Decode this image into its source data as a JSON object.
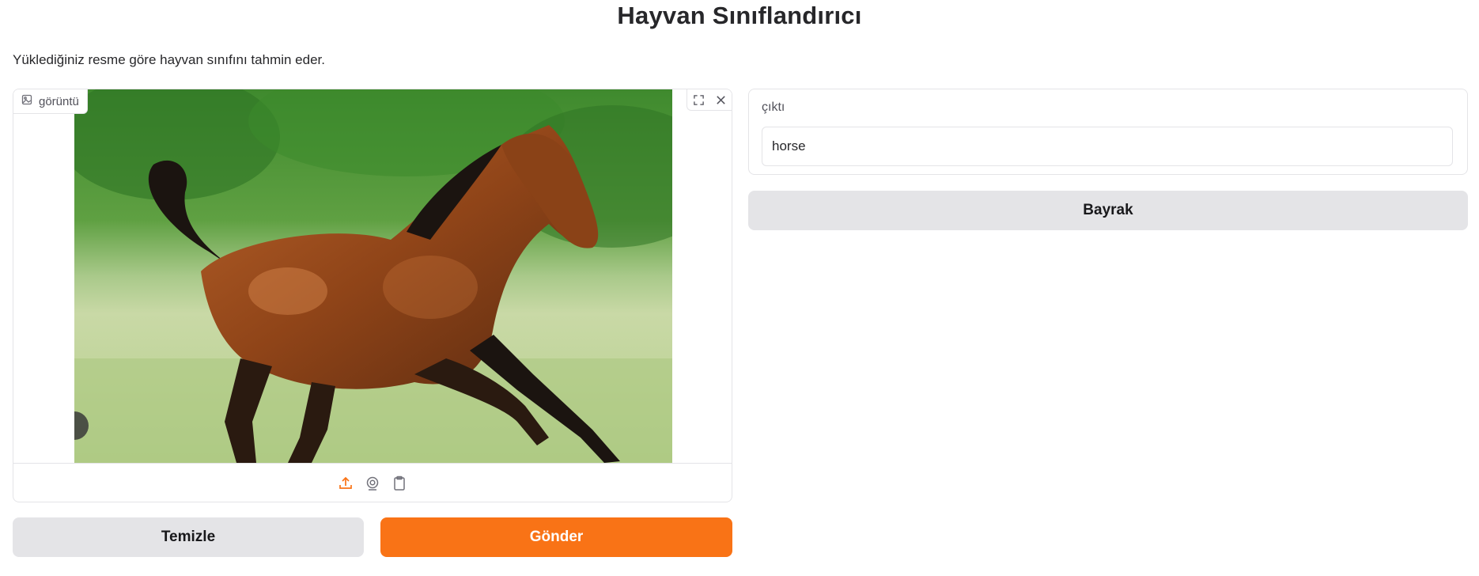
{
  "page": {
    "title": "Hayvan Sınıflandırıcı",
    "description": "Yüklediğiniz resme göre hayvan sınıfını tahmin eder."
  },
  "image_input": {
    "label": "görüntü",
    "icons": [
      "image-icon",
      "fullscreen-icon",
      "close-icon",
      "upload-icon",
      "webcam-icon",
      "clipboard-icon"
    ]
  },
  "buttons": {
    "clear": "Temizle",
    "submit": "Gönder",
    "flag": "Bayrak"
  },
  "output": {
    "label": "çıktı",
    "value": "horse"
  },
  "colors": {
    "primary": "#f97316",
    "secondary": "#e4e4e7"
  }
}
